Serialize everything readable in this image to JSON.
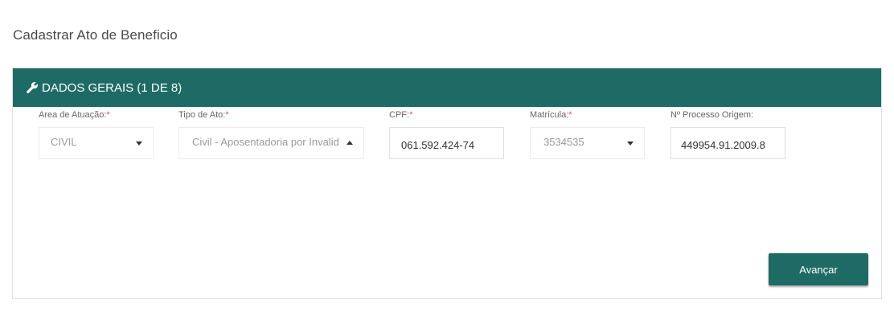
{
  "page": {
    "title": "Cadastrar Ato de Beneficio"
  },
  "panel": {
    "header_icon": "wrench-icon",
    "header_title": "DADOS GERAIS (1 DE 8)",
    "header_color": "#1e6b65"
  },
  "fields": {
    "area": {
      "label": "Area de Atuação:",
      "required_mark": "*",
      "value": "CIVIL",
      "caret": "caret-down-icon"
    },
    "tipo": {
      "label": "Tipo de Ato:",
      "required_mark": "*",
      "value": "Civil - Aposentadoria por Invalidez",
      "caret": "caret-up-icon"
    },
    "cpf": {
      "label": "CPF:",
      "required_mark": "*",
      "value": "061.592.424-74"
    },
    "matricula": {
      "label": "Matrícula:",
      "required_mark": "*",
      "value": "3534535",
      "caret": "caret-down-icon"
    },
    "processo": {
      "label": "Nº Processo Origem:",
      "value": "449954.91.2009.8"
    }
  },
  "actions": {
    "next_label": "Avançar",
    "button_color": "#1e6b65"
  }
}
